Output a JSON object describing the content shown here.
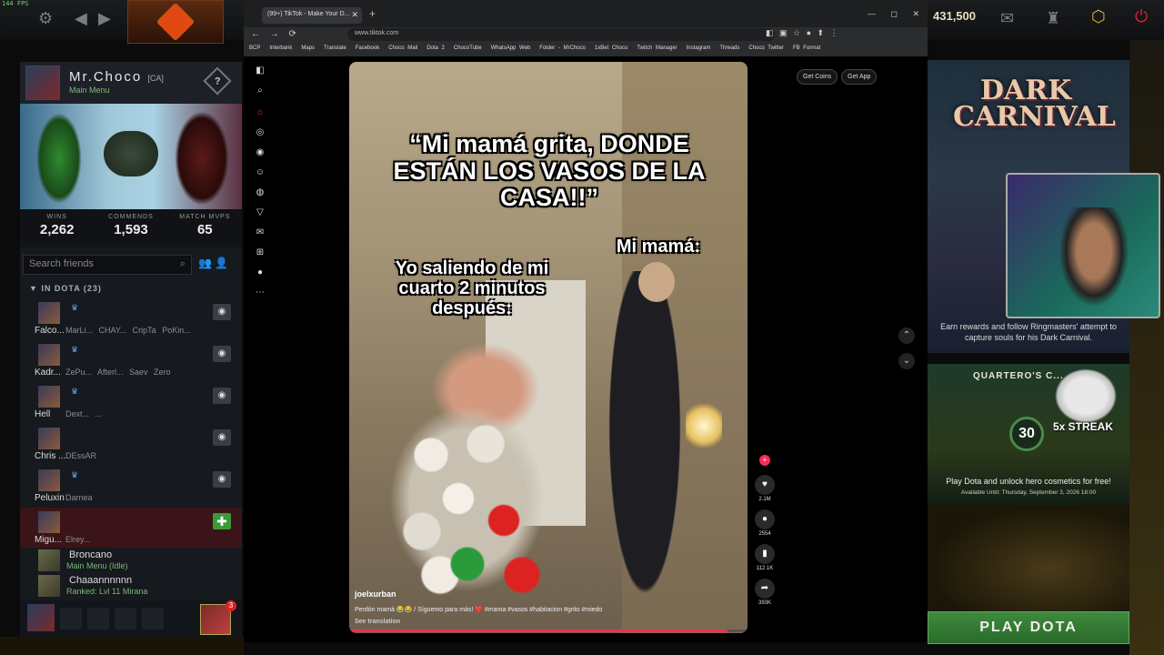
{
  "top_bar": {
    "fps": "144 FPS",
    "gold": "431,500"
  },
  "profile": {
    "name": "Mr.Choco",
    "tag": "[CA]",
    "status": "Main Menu",
    "stats": [
      {
        "label": "WINS",
        "value": "2,262"
      },
      {
        "label": "COMMENDS",
        "value": "1,593"
      },
      {
        "label": "MATCH MVPS",
        "value": "65"
      }
    ]
  },
  "friends": {
    "search_placeholder": "Search friends",
    "section": "IN DOTA (23)",
    "rows": [
      {
        "name": "Falco...",
        "party": "MarLi... CHAY... CripTa PoKin..."
      },
      {
        "name": "Kadr...",
        "party": "ZePu... Afterl... Saev Zero"
      },
      {
        "name": "Hell",
        "party": "Dext... ...",
        "extra": "...论 ..."
      },
      {
        "name": "Chris ...",
        "party": "DEssAR"
      },
      {
        "name": "Peluxin",
        "party": "Darnea"
      },
      {
        "name": "Migu...",
        "party": "Elrey..."
      }
    ],
    "others": [
      {
        "name": "Broncano",
        "status": "Main Menu (Idle)"
      },
      {
        "name": "Chaaannnnnn",
        "status": "Ranked: Lvl 11 Mirana"
      }
    ],
    "notif_count": "3"
  },
  "browser": {
    "tab_title": "(99+) TikTok - Make Your D...",
    "url": "www.tiktok.com",
    "bookmarks": [
      "BCP",
      "Interbank",
      "Maps",
      "Translate",
      "Facebook",
      "Choco Mail",
      "Dota 2",
      "ChocoTube",
      "WhatsApp Web",
      "Folder - MrChoco",
      "1xBet Choco",
      "Twitch Manager",
      "Instagram",
      "Threads",
      "Choco Twitter",
      "FB Format"
    ]
  },
  "tiktok": {
    "get_coins": "Get Coins",
    "get_app": "Get App",
    "caption_top": "“Mi mamá grita, DONDE ESTÁN LOS VASOS DE LA CASA!!”",
    "caption_mom": "Mi mamá:",
    "caption_me": "Yo saliendo de mi cuarto 2 minutos después:",
    "author": "joelxurban",
    "description": "Perdón mamá 😂😂 / Síguemo para más! ❤️ #mama #vasos #habitacion #grito #miedo",
    "see_translation": "See translation",
    "likes": "2.1M",
    "comments": "2554",
    "saves": "112.1K",
    "shares": "393K"
  },
  "events": {
    "carnival_title": "DARK CARNIVAL",
    "carnival_text": "Earn rewards and follow Ringmasters' attempt to capture souls for his Dark Carnival.",
    "quartero_title": "QUARTERO'S C...",
    "streak_num": "30",
    "streak_label": "5x STREAK",
    "quartero_text": "Play Dota and unlock hero cosmetics for free!",
    "available": "Available Until:  Thursday, September 3, 2026 18:00",
    "play_button": "PLAY DOTA"
  }
}
